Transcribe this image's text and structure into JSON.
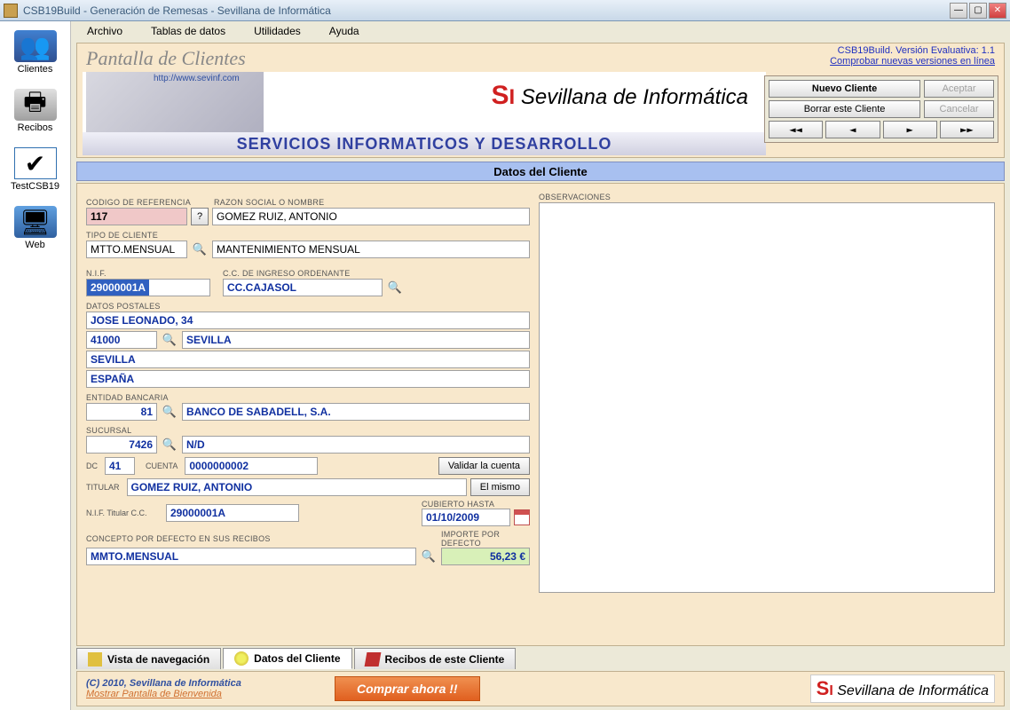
{
  "window": {
    "title": "CSB19Build - Generación de Remesas - Sevillana de Informática"
  },
  "menu": {
    "items": [
      "Archivo",
      "Tablas de datos",
      "Utilidades",
      "Ayuda"
    ]
  },
  "sidebar": {
    "items": [
      {
        "label": "Clientes"
      },
      {
        "label": "Recibos"
      },
      {
        "label": "TestCSB19"
      },
      {
        "label": "Web"
      }
    ]
  },
  "header": {
    "title": "Pantalla de Clientes",
    "banner_url": "http://www.sevinf.com",
    "banner_brand": "Sevillana de Informática",
    "banner_tagline": "SERVICIOS INFORMATICOS Y DESARROLLO"
  },
  "version": {
    "text": "CSB19Build. Versión Evaluativa:  1.1",
    "link": "Comprobar nuevas versiones en línea"
  },
  "buttons": {
    "new": "Nuevo Cliente",
    "delete": "Borrar este Cliente",
    "accept": "Aceptar",
    "cancel": "Cancelar",
    "nav": [
      "◄◄",
      "◄",
      "►",
      "►►"
    ]
  },
  "section": {
    "title": "Datos del Cliente"
  },
  "form": {
    "labels": {
      "codigo": "CODIGO DE REFERENCIA",
      "razon": "RAZON SOCIAL O NOMBRE",
      "tipo": "TIPO DE CLIENTE",
      "nif": "N.I.F.",
      "cc_ord": "C.C. DE INGRESO ORDENANTE",
      "postales": "DATOS POSTALES",
      "entidad": "ENTIDAD BANCARIA",
      "sucursal": "SUCURSAL",
      "dc": "DC",
      "cuenta": "CUENTA",
      "titular": "TITULAR",
      "nif_tit": "N.I.F. Titular C.C.",
      "cubierto": "CUBIERTO HASTA",
      "concepto": "CONCEPTO POR DEFECTO EN SUS RECIBOS",
      "importe": "IMPORTE POR DEFECTO",
      "obs": "OBSERVACIONES"
    },
    "values": {
      "codigo": "117",
      "razon": "GOMEZ RUIZ, ANTONIO",
      "tipo_code": "MTTO.MENSUAL",
      "tipo_desc": "MANTENIMIENTO MENSUAL",
      "nif": "29000001A",
      "cc_ord": "CC.CAJASOL",
      "dir": "JOSE LEONADO, 34",
      "cp": "41000",
      "ciudad": "SEVILLA",
      "prov": "SEVILLA",
      "pais": "ESPAÑA",
      "entidad_code": "81",
      "entidad_name": "BANCO DE SABADELL, S.A.",
      "sucursal_code": "7426",
      "sucursal_name": "N/D",
      "dc": "41",
      "cuenta": "0000000002",
      "titular": "GOMEZ RUIZ, ANTONIO",
      "nif_tit": "29000001A",
      "cubierto": "01/10/2009",
      "concepto": "MMTO.MENSUAL",
      "importe": "56,23 €"
    },
    "buttons": {
      "validar": "Validar la cuenta",
      "mismo": "El mismo"
    }
  },
  "tabs": {
    "items": [
      {
        "label": "Vista de navegación"
      },
      {
        "label": "Datos del Cliente"
      },
      {
        "label": "Recibos de este Cliente"
      }
    ]
  },
  "footer": {
    "copy": "(C) 2010, Sevillana de Informática",
    "welcome": "Mostrar Pantalla de Bienvenida",
    "buy": "Comprar ahora !!",
    "brand": "Sevillana de Informática"
  }
}
